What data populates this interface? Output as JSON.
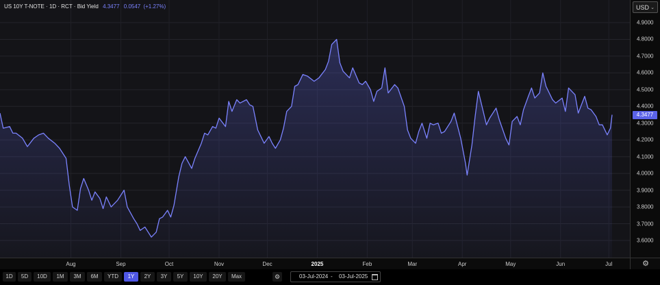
{
  "legend": {
    "title": "US 10Y T-NOTE · 1D · RCT · Bid Yield",
    "last": "4.3477",
    "change": "0.0547",
    "change_pct": "(+1.27%)"
  },
  "currency": {
    "label": "USD",
    "chevron": "⌄"
  },
  "price_tag": "4.3477",
  "settings_icon": "⚙",
  "timeframes": [
    {
      "label": "1D",
      "active": false
    },
    {
      "label": "5D",
      "active": false
    },
    {
      "label": "10D",
      "active": false
    },
    {
      "label": "1M",
      "active": false
    },
    {
      "label": "3M",
      "active": false
    },
    {
      "label": "6M",
      "active": false
    },
    {
      "label": "YTD",
      "active": false
    },
    {
      "label": "1Y",
      "active": true
    },
    {
      "label": "2Y",
      "active": false
    },
    {
      "label": "3Y",
      "active": false
    },
    {
      "label": "5Y",
      "active": false
    },
    {
      "label": "10Y",
      "active": false
    },
    {
      "label": "20Y",
      "active": false
    },
    {
      "label": "Max",
      "active": false
    }
  ],
  "date_range": {
    "from": "03-Jul-2024",
    "separator": "-",
    "to": "03-Jul-2025"
  },
  "colors": {
    "line": "#7b83ff",
    "accent": "#4f57e6",
    "background": "#141418"
  },
  "chart_data": {
    "type": "area",
    "title": "US 10Y T-NOTE · 1D · RCT · Bid Yield",
    "ylim": [
      3.5,
      5.0
    ],
    "yticks": [
      "3.6000",
      "3.7000",
      "3.8000",
      "3.9000",
      "4.0000",
      "4.1000",
      "4.2000",
      "4.3000",
      "4.4000",
      "4.5000",
      "4.6000",
      "4.7000",
      "4.8000",
      "4.9000"
    ],
    "x_labels": [
      {
        "label": "Aug",
        "date": "2024-08-01",
        "bold": false
      },
      {
        "label": "Sep",
        "date": "2024-09-01",
        "bold": false
      },
      {
        "label": "Oct",
        "date": "2024-10-01",
        "bold": false
      },
      {
        "label": "Nov",
        "date": "2024-11-01",
        "bold": false
      },
      {
        "label": "Dec",
        "date": "2024-12-01",
        "bold": false
      },
      {
        "label": "2025",
        "date": "2025-01-01",
        "bold": true
      },
      {
        "label": "Feb",
        "date": "2025-02-01",
        "bold": false
      },
      {
        "label": "Mar",
        "date": "2025-03-01",
        "bold": false
      },
      {
        "label": "Apr",
        "date": "2025-04-01",
        "bold": false
      },
      {
        "label": "May",
        "date": "2025-05-01",
        "bold": false
      },
      {
        "label": "Jun",
        "date": "2025-06-01",
        "bold": false
      },
      {
        "label": "Jul",
        "date": "2025-07-01",
        "bold": false
      }
    ],
    "grid": true,
    "legend_position": "top-left",
    "series": [
      {
        "name": "US 10Y T-NOTE",
        "points": [
          [
            "2024-06-18",
            4.36
          ],
          [
            "2024-06-20",
            4.27
          ],
          [
            "2024-06-24",
            4.28
          ],
          [
            "2024-06-26",
            4.24
          ],
          [
            "2024-06-28",
            4.24
          ],
          [
            "2024-07-02",
            4.21
          ],
          [
            "2024-07-05",
            4.16
          ],
          [
            "2024-07-09",
            4.21
          ],
          [
            "2024-07-12",
            4.23
          ],
          [
            "2024-07-15",
            4.24
          ],
          [
            "2024-07-18",
            4.21
          ],
          [
            "2024-07-22",
            4.18
          ],
          [
            "2024-07-25",
            4.15
          ],
          [
            "2024-07-29",
            4.09
          ],
          [
            "2024-07-31",
            3.93
          ],
          [
            "2024-08-02",
            3.8
          ],
          [
            "2024-08-05",
            3.78
          ],
          [
            "2024-08-07",
            3.91
          ],
          [
            "2024-08-09",
            3.97
          ],
          [
            "2024-08-12",
            3.9
          ],
          [
            "2024-08-14",
            3.84
          ],
          [
            "2024-08-16",
            3.89
          ],
          [
            "2024-08-19",
            3.85
          ],
          [
            "2024-08-21",
            3.79
          ],
          [
            "2024-08-23",
            3.86
          ],
          [
            "2024-08-26",
            3.8
          ],
          [
            "2024-08-28",
            3.82
          ],
          [
            "2024-08-30",
            3.84
          ],
          [
            "2024-09-03",
            3.9
          ],
          [
            "2024-09-05",
            3.8
          ],
          [
            "2024-09-09",
            3.73
          ],
          [
            "2024-09-11",
            3.7
          ],
          [
            "2024-09-13",
            3.66
          ],
          [
            "2024-09-16",
            3.68
          ],
          [
            "2024-09-18",
            3.65
          ],
          [
            "2024-09-20",
            3.62
          ],
          [
            "2024-09-23",
            3.65
          ],
          [
            "2024-09-25",
            3.73
          ],
          [
            "2024-09-27",
            3.74
          ],
          [
            "2024-09-30",
            3.78
          ],
          [
            "2024-10-02",
            3.74
          ],
          [
            "2024-10-04",
            3.81
          ],
          [
            "2024-10-07",
            3.98
          ],
          [
            "2024-10-09",
            4.06
          ],
          [
            "2024-10-11",
            4.1
          ],
          [
            "2024-10-15",
            4.03
          ],
          [
            "2024-10-17",
            4.09
          ],
          [
            "2024-10-21",
            4.18
          ],
          [
            "2024-10-23",
            4.24
          ],
          [
            "2024-10-25",
            4.23
          ],
          [
            "2024-10-28",
            4.28
          ],
          [
            "2024-10-30",
            4.27
          ],
          [
            "2024-11-01",
            4.33
          ],
          [
            "2024-11-05",
            4.28
          ],
          [
            "2024-11-07",
            4.43
          ],
          [
            "2024-11-09",
            4.37
          ],
          [
            "2024-11-12",
            4.44
          ],
          [
            "2024-11-14",
            4.42
          ],
          [
            "2024-11-18",
            4.44
          ],
          [
            "2024-11-20",
            4.41
          ],
          [
            "2024-11-22",
            4.4
          ],
          [
            "2024-11-25",
            4.26
          ],
          [
            "2024-11-27",
            4.22
          ],
          [
            "2024-11-29",
            4.18
          ],
          [
            "2024-12-02",
            4.22
          ],
          [
            "2024-12-04",
            4.18
          ],
          [
            "2024-12-06",
            4.15
          ],
          [
            "2024-12-09",
            4.2
          ],
          [
            "2024-12-11",
            4.27
          ],
          [
            "2024-12-13",
            4.37
          ],
          [
            "2024-12-16",
            4.4
          ],
          [
            "2024-12-18",
            4.52
          ],
          [
            "2024-12-20",
            4.53
          ],
          [
            "2024-12-23",
            4.59
          ],
          [
            "2024-12-26",
            4.58
          ],
          [
            "2024-12-30",
            4.55
          ],
          [
            "2025-01-02",
            4.57
          ],
          [
            "2025-01-06",
            4.62
          ],
          [
            "2025-01-08",
            4.67
          ],
          [
            "2025-01-10",
            4.77
          ],
          [
            "2025-01-13",
            4.8
          ],
          [
            "2025-01-15",
            4.66
          ],
          [
            "2025-01-17",
            4.61
          ],
          [
            "2025-01-21",
            4.57
          ],
          [
            "2025-01-23",
            4.63
          ],
          [
            "2025-01-27",
            4.54
          ],
          [
            "2025-01-29",
            4.53
          ],
          [
            "2025-01-31",
            4.55
          ],
          [
            "2025-02-03",
            4.5
          ],
          [
            "2025-02-05",
            4.43
          ],
          [
            "2025-02-07",
            4.49
          ],
          [
            "2025-02-10",
            4.51
          ],
          [
            "2025-02-12",
            4.63
          ],
          [
            "2025-02-14",
            4.48
          ],
          [
            "2025-02-18",
            4.53
          ],
          [
            "2025-02-20",
            4.51
          ],
          [
            "2025-02-24",
            4.4
          ],
          [
            "2025-02-26",
            4.26
          ],
          [
            "2025-02-28",
            4.21
          ],
          [
            "2025-03-03",
            4.18
          ],
          [
            "2025-03-05",
            4.25
          ],
          [
            "2025-03-07",
            4.3
          ],
          [
            "2025-03-10",
            4.21
          ],
          [
            "2025-03-12",
            4.3
          ],
          [
            "2025-03-14",
            4.29
          ],
          [
            "2025-03-17",
            4.3
          ],
          [
            "2025-03-19",
            4.24
          ],
          [
            "2025-03-21",
            4.25
          ],
          [
            "2025-03-25",
            4.31
          ],
          [
            "2025-03-27",
            4.36
          ],
          [
            "2025-03-31",
            4.21
          ],
          [
            "2025-04-03",
            4.06
          ],
          [
            "2025-04-04",
            3.99
          ],
          [
            "2025-04-07",
            4.17
          ],
          [
            "2025-04-09",
            4.34
          ],
          [
            "2025-04-11",
            4.49
          ],
          [
            "2025-04-14",
            4.37
          ],
          [
            "2025-04-16",
            4.29
          ],
          [
            "2025-04-18",
            4.33
          ],
          [
            "2025-04-22",
            4.39
          ],
          [
            "2025-04-24",
            4.32
          ],
          [
            "2025-04-28",
            4.21
          ],
          [
            "2025-04-30",
            4.17
          ],
          [
            "2025-05-02",
            4.31
          ],
          [
            "2025-05-05",
            4.34
          ],
          [
            "2025-05-07",
            4.29
          ],
          [
            "2025-05-09",
            4.38
          ],
          [
            "2025-05-12",
            4.46
          ],
          [
            "2025-05-14",
            4.51
          ],
          [
            "2025-05-16",
            4.45
          ],
          [
            "2025-05-19",
            4.48
          ],
          [
            "2025-05-21",
            4.6
          ],
          [
            "2025-05-23",
            4.52
          ],
          [
            "2025-05-27",
            4.44
          ],
          [
            "2025-05-29",
            4.42
          ],
          [
            "2025-06-02",
            4.45
          ],
          [
            "2025-06-04",
            4.37
          ],
          [
            "2025-06-06",
            4.51
          ],
          [
            "2025-06-10",
            4.47
          ],
          [
            "2025-06-12",
            4.36
          ],
          [
            "2025-06-16",
            4.46
          ],
          [
            "2025-06-18",
            4.39
          ],
          [
            "2025-06-20",
            4.38
          ],
          [
            "2025-06-23",
            4.34
          ],
          [
            "2025-06-25",
            4.29
          ],
          [
            "2025-06-27",
            4.29
          ],
          [
            "2025-06-30",
            4.23
          ],
          [
            "2025-07-02",
            4.27
          ],
          [
            "2025-07-03",
            4.35
          ]
        ]
      }
    ]
  }
}
